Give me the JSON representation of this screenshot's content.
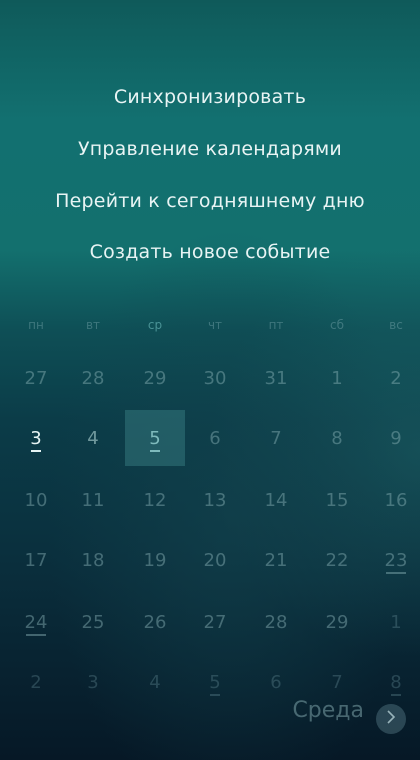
{
  "menu": {
    "items": [
      {
        "label": "Синхронизировать"
      },
      {
        "label": "Управление календарями"
      },
      {
        "label": "Перейти к сегодняшнему дню"
      },
      {
        "label": "Создать новое событие"
      }
    ]
  },
  "calendar": {
    "weekdays": [
      "пн",
      "вт",
      "ср",
      "чт",
      "пт",
      "сб",
      "вс"
    ],
    "selected_column": 2,
    "weeks": [
      [
        {
          "label": "27",
          "style": "normal"
        },
        {
          "label": "28",
          "style": "normal"
        },
        {
          "label": "29",
          "style": "normal"
        },
        {
          "label": "30",
          "style": "normal"
        },
        {
          "label": "31",
          "style": "normal"
        },
        {
          "label": "1",
          "style": "normal"
        },
        {
          "label": "2",
          "style": "normal"
        }
      ],
      [
        {
          "label": "3",
          "style": "today",
          "event": true
        },
        {
          "label": "4",
          "style": "bright"
        },
        {
          "label": "5",
          "style": "selected",
          "event": true
        },
        {
          "label": "6",
          "style": "normal"
        },
        {
          "label": "7",
          "style": "normal"
        },
        {
          "label": "8",
          "style": "normal"
        },
        {
          "label": "9",
          "style": "normal"
        }
      ],
      [
        {
          "label": "10",
          "style": "normal"
        },
        {
          "label": "11",
          "style": "normal"
        },
        {
          "label": "12",
          "style": "normal"
        },
        {
          "label": "13",
          "style": "normal"
        },
        {
          "label": "14",
          "style": "normal"
        },
        {
          "label": "15",
          "style": "normal"
        },
        {
          "label": "16",
          "style": "normal"
        }
      ],
      [
        {
          "label": "17",
          "style": "normal"
        },
        {
          "label": "18",
          "style": "normal"
        },
        {
          "label": "19",
          "style": "normal"
        },
        {
          "label": "20",
          "style": "normal"
        },
        {
          "label": "21",
          "style": "normal"
        },
        {
          "label": "22",
          "style": "normal"
        },
        {
          "label": "23",
          "style": "normal",
          "event": true
        }
      ],
      [
        {
          "label": "24",
          "style": "normal",
          "event": true
        },
        {
          "label": "25",
          "style": "normal"
        },
        {
          "label": "26",
          "style": "normal"
        },
        {
          "label": "27",
          "style": "normal"
        },
        {
          "label": "28",
          "style": "normal"
        },
        {
          "label": "29",
          "style": "normal"
        },
        {
          "label": "1",
          "style": "dim"
        }
      ],
      [
        {
          "label": "2",
          "style": "dim"
        },
        {
          "label": "3",
          "style": "dim"
        },
        {
          "label": "4",
          "style": "dim"
        },
        {
          "label": "5",
          "style": "dim",
          "event": true
        },
        {
          "label": "6",
          "style": "dim"
        },
        {
          "label": "7",
          "style": "dim"
        },
        {
          "label": "8",
          "style": "dim",
          "event": true
        }
      ]
    ]
  },
  "footer": {
    "selected_day_label": "Среда",
    "next_icon": "chevron-right-icon"
  }
}
